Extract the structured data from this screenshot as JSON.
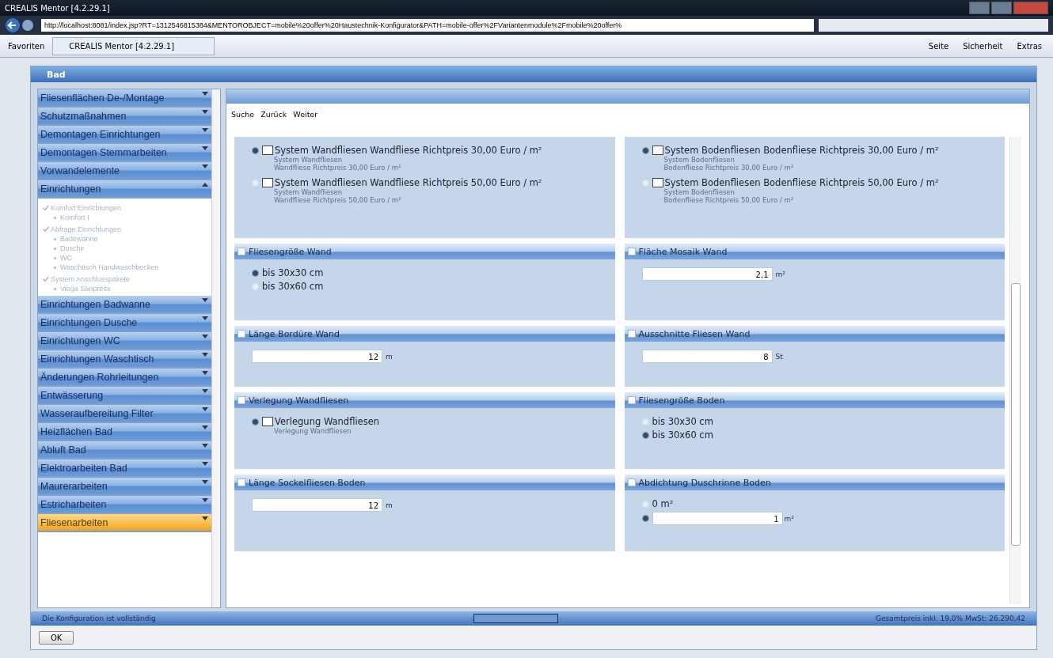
{
  "window": {
    "title": "CREALIS Mentor [4.2.29.1]"
  },
  "address_bar": {
    "url": "http://localhost:8081/index.jsp?RT=1312546815384&MENTOROBJECT=mobile%20offer%20Haustechnik-Konfigurator&PATH=mobile-offer%2FVariantenmodule%2Fmobile%20offer%"
  },
  "favorites_bar": {
    "favorites": "Favoriten",
    "tab": "CREALIS Mentor [4.2.29.1]",
    "menus": [
      "Seite",
      "Sicherheit",
      "Extras"
    ]
  },
  "app_header": {
    "breadcrumb": "Bad"
  },
  "sidebar": {
    "sections": [
      {
        "label": "Fliesenflächen De-/Montage",
        "expanded": false,
        "selected": false
      },
      {
        "label": "Schutzmaßnahmen",
        "expanded": false,
        "selected": false
      },
      {
        "label": "Demontagen Einrichtungen",
        "expanded": false,
        "selected": false
      },
      {
        "label": "Demontagen Stemmarbeiten",
        "expanded": false,
        "selected": false
      },
      {
        "label": "Vorwandelemente",
        "expanded": false,
        "selected": false
      },
      {
        "label": "Einrichtungen",
        "expanded": true,
        "selected": false,
        "children": [
          {
            "label": "Komfort Einrichtungen",
            "children": [
              {
                "label": "Komfort I"
              }
            ]
          },
          {
            "label": "Abfrage Einrichtungen",
            "children": [
              {
                "label": "Badewanne"
              },
              {
                "label": "Dusche"
              },
              {
                "label": "WC"
              },
              {
                "label": "Waschtisch Handwaschbecken"
              }
            ]
          },
          {
            "label": "System Anschlusspakete",
            "children": [
              {
                "label": "Viega Sanpress"
              }
            ]
          }
        ]
      },
      {
        "label": "Einrichtungen Badwanne",
        "expanded": false,
        "selected": false
      },
      {
        "label": "Einrichtungen Dusche",
        "expanded": false,
        "selected": false
      },
      {
        "label": "Einrichtungen WC",
        "expanded": false,
        "selected": false
      },
      {
        "label": "Einrichtungen Waschtisch",
        "expanded": false,
        "selected": false
      },
      {
        "label": "Änderungen Rohrleitungen",
        "expanded": false,
        "selected": false
      },
      {
        "label": "Entwässerung",
        "expanded": false,
        "selected": false
      },
      {
        "label": "Wasseraufbereitung Filter",
        "expanded": false,
        "selected": false
      },
      {
        "label": "Heizflächen Bad",
        "expanded": false,
        "selected": false
      },
      {
        "label": "Abluft Bad",
        "expanded": false,
        "selected": false
      },
      {
        "label": "Elektroarbeiten Bad",
        "expanded": false,
        "selected": false
      },
      {
        "label": "Maurerarbeiten",
        "expanded": false,
        "selected": false
      },
      {
        "label": "Estricharbeiten",
        "expanded": false,
        "selected": false
      },
      {
        "label": "Fliesenarbeiten",
        "expanded": false,
        "selected": true
      }
    ]
  },
  "toolbar": {
    "links": [
      "Suche",
      "Zurück",
      "Weiter"
    ]
  },
  "panels": [
    {
      "kind": "options",
      "options": [
        {
          "kind": "choice",
          "selected": true,
          "label": "System Wandfliesen Wandfliese Richtpreis 30,00 Euro / m²",
          "details": [
            "System Wandfliesen",
            "Wandfliese Richtpreis 30,00 Euro / m²"
          ]
        },
        {
          "kind": "choice",
          "selected": false,
          "label": "System Wandfliesen Wandfliese Richtpreis 50,00 Euro / m²",
          "details": [
            "System Wandfliesen",
            "Wandfliese Richtpreis 50,00 Euro / m²"
          ]
        }
      ]
    },
    {
      "kind": "options",
      "options": [
        {
          "kind": "choice",
          "selected": true,
          "label": "System Bodenfliesen Bodenfliese Richtpreis 30,00 Euro / m²",
          "details": [
            "System Bodenfliesen",
            "Bodenfliese Richtpreis 30,00 Euro / m²"
          ]
        },
        {
          "kind": "choice",
          "selected": false,
          "label": "System Bodenfliesen Bodenfliese Richtpreis 50,00 Euro / m²",
          "details": [
            "System Bodenfliesen",
            "Bodenfliese Richtpreis 50,00 Euro / m²"
          ]
        }
      ]
    },
    {
      "kind": "options",
      "title": "Fliesengröße Wand",
      "options": [
        {
          "kind": "radio",
          "selected": true,
          "label": "bis 30x30 cm"
        },
        {
          "kind": "radio",
          "selected": false,
          "label": "bis 30x60 cm"
        }
      ]
    },
    {
      "kind": "input",
      "title": "Fläche Mosaik Wand",
      "value": "2,1",
      "unit": "m²"
    },
    {
      "kind": "input",
      "title": "Länge Bordüre Wand",
      "value": "12",
      "unit": "m"
    },
    {
      "kind": "input",
      "title": "Ausschnitte Fliesen Wand",
      "value": "8",
      "unit": "St"
    },
    {
      "kind": "options",
      "title": "Verlegung Wandfliesen",
      "options": [
        {
          "kind": "choice",
          "selected": true,
          "label": "Verlegung Wandfliesen",
          "details": [
            "Verlegung Wandfliesen"
          ]
        }
      ]
    },
    {
      "kind": "options",
      "title": "Fliesengröße Boden",
      "options": [
        {
          "kind": "radio",
          "selected": false,
          "label": "bis 30x30 cm"
        },
        {
          "kind": "radio",
          "selected": true,
          "label": "bis 30x60 cm"
        }
      ]
    },
    {
      "kind": "input",
      "title": "Länge Sockelfliesen Boden",
      "value": "12",
      "unit": "m"
    },
    {
      "kind": "options",
      "title": "Abdichtung Duschrinne Boden",
      "options": [
        {
          "kind": "radio",
          "selected": false,
          "label": "0 m²"
        },
        {
          "kind": "radio_input",
          "selected": true,
          "value": "1",
          "unit": "m²"
        }
      ]
    }
  ],
  "status_bar": {
    "message": "Die Konfiguration ist vollständig",
    "total": "Gesamtpreis inkl. 19,0% MwSt: 26.290,42"
  },
  "buttons": [
    "OK"
  ]
}
